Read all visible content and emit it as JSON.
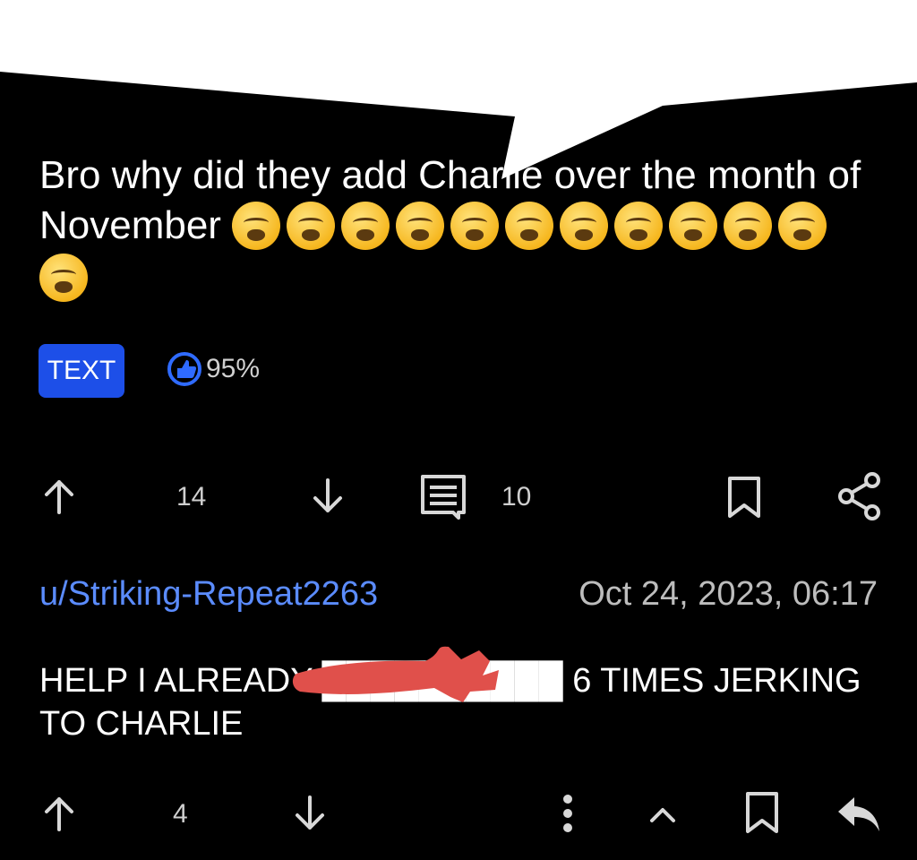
{
  "post": {
    "title": "Bro why did they add Charlie over the month of November",
    "emoji_count": 12,
    "badge": "TEXT",
    "upvote_ratio": "95%",
    "votes": "14",
    "comments": "10"
  },
  "comment": {
    "author": "u/Striking-Repeat2263",
    "timestamp": "Oct 24, 2023, 06:17",
    "body": "HELP I ALREADY ██████████ 6 TIMES JERKING TO CHARLIE",
    "votes": "4"
  },
  "colors": {
    "background": "#000000",
    "badge": "#1d4fe8",
    "username": "#5b8cff",
    "redaction": "#e0504b"
  },
  "icons": {
    "upvote": "arrow-up-icon",
    "downvote": "arrow-down-icon",
    "comments": "comment-icon",
    "save": "bookmark-icon",
    "share": "share-icon",
    "more": "more-vertical-icon",
    "collapse": "chevron-up-icon",
    "reply": "reply-icon",
    "ratio": "thumbs-up-icon"
  }
}
